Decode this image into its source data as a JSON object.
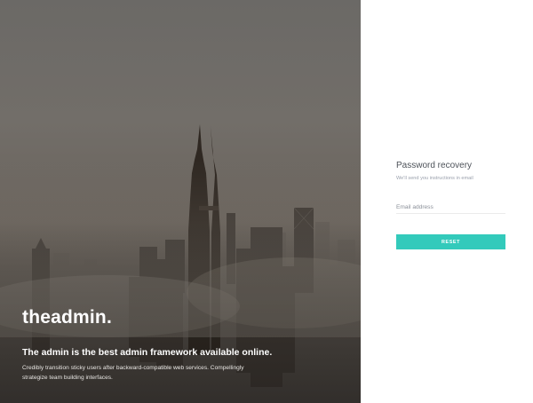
{
  "hero": {
    "brand": "theadmin.",
    "tagline": "The admin is the best admin framework available online.",
    "description": "Credibly transition sticky users after backward-compatible web services. Compellingly strategize team building interfaces."
  },
  "recovery": {
    "title": "Password recovery",
    "subtitle": "We'll send you instructions in email",
    "email_placeholder": "Email address",
    "email_value": "",
    "reset_label": "RESET"
  },
  "colors": {
    "accent": "#33cabb",
    "panel_background": "#ffffff",
    "title_text": "#4d5259"
  }
}
